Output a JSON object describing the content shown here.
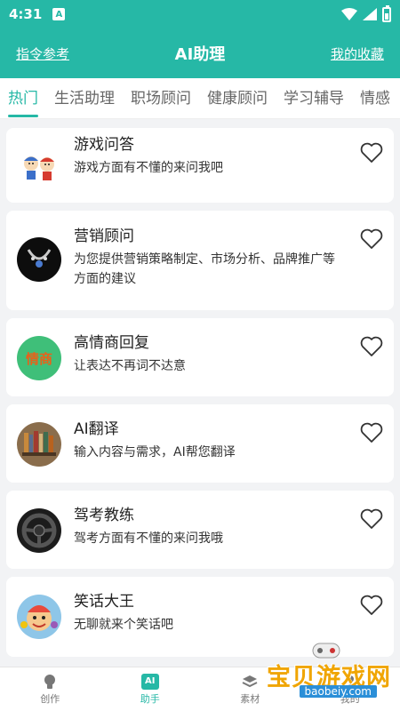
{
  "status": {
    "time": "4:31",
    "app_badge": "A"
  },
  "header": {
    "left_link": "指令参考",
    "title": "AI助理",
    "right_link": "我的收藏"
  },
  "tabs": [
    {
      "label": "热门",
      "active": true
    },
    {
      "label": "生活助理"
    },
    {
      "label": "职场顾问"
    },
    {
      "label": "健康顾问"
    },
    {
      "label": "学习辅导"
    },
    {
      "label": "情感"
    }
  ],
  "cards": [
    {
      "title": "游戏问答",
      "desc": "游戏方面有不懂的来问我吧",
      "icon": "cartoon-kids-icon"
    },
    {
      "title": "营销顾问",
      "desc": "为您提供营销策略制定、市场分析、品牌推广等方面的建议",
      "icon": "necklace-icon"
    },
    {
      "title": "高情商回复",
      "desc": "让表达不再词不达意",
      "icon": "badge-text-icon",
      "badge_text": "情商"
    },
    {
      "title": "AI翻译",
      "desc": "输入内容与需求，AI帮您翻译",
      "icon": "bookshelf-icon"
    },
    {
      "title": "驾考教练",
      "desc": "驾考方面有不懂的来问我哦",
      "icon": "steering-wheel-icon"
    },
    {
      "title": "笑话大王",
      "desc": "无聊就来个笑话吧",
      "icon": "clown-icon"
    }
  ],
  "nav": [
    {
      "label": "创作",
      "icon": "bulb-icon"
    },
    {
      "label": "助手",
      "icon": "ai-icon",
      "icon_text": "AI",
      "active": true
    },
    {
      "label": "素材",
      "icon": "layers-icon"
    },
    {
      "label": "我的",
      "icon": "user-icon"
    }
  ],
  "watermark": {
    "text": "宝贝游戏网",
    "url": "baobeiy.com"
  },
  "colors": {
    "primary": "#26b8a6",
    "badge_green": "#3fbf79",
    "badge_text": "#e8611a"
  }
}
